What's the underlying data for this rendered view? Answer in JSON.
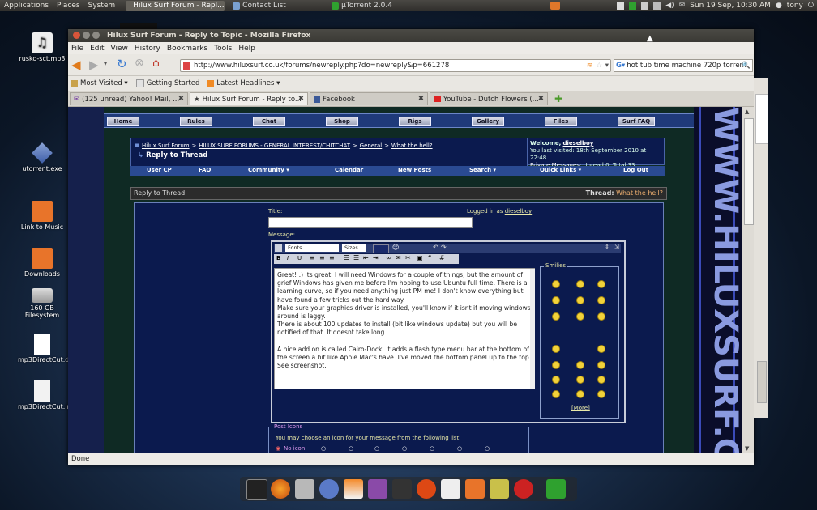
{
  "top_panel": {
    "menus": [
      "Applications",
      "Places",
      "System"
    ],
    "tasks": [
      {
        "label": "Hilux Surf Forum - Repl...",
        "active": true
      },
      {
        "label": "Contact List",
        "active": false
      },
      {
        "label": "µTorrent 2.0.4",
        "active": false
      }
    ],
    "clock": "Sun 19 Sep, 10:30 AM",
    "user": "tony"
  },
  "desktop_icons": [
    {
      "label": "rusko-sct.mp3",
      "icon": "music-file-icon"
    },
    {
      "label": "utorrent.exe",
      "icon": "executable-icon"
    },
    {
      "label": "Link to Music",
      "icon": "folder-icon"
    },
    {
      "label": "Downloads",
      "icon": "folder-icon"
    },
    {
      "label": "160 GB Filesystem",
      "icon": "drive-icon"
    },
    {
      "label": "mp3DirectCut.desktop",
      "icon": "text-file-icon"
    },
    {
      "label": "mp3DirectCut.lnk",
      "icon": "file-icon"
    }
  ],
  "firefox": {
    "window_title": "Hilux Surf Forum - Reply to Topic - Mozilla Firefox",
    "menus": [
      "File",
      "Edit",
      "View",
      "History",
      "Bookmarks",
      "Tools",
      "Help"
    ],
    "url": "http://www.hiluxsurf.co.uk/forums/newreply.php?do=newreply&p=661278",
    "search_text": "hot tub time machine 720p torrent",
    "bookmarks": [
      "Most Visited ▾",
      "Getting Started",
      "Latest Headlines ▾"
    ],
    "tabs": [
      {
        "label": "(125 unread) Yahoo! Mail, ...",
        "active": false
      },
      {
        "label": "Hilux Surf Forum - Reply to...",
        "active": true
      },
      {
        "label": "Facebook",
        "active": false
      },
      {
        "label": "YouTube - Dutch Flowers (...",
        "active": false
      }
    ],
    "status": "Done"
  },
  "forum": {
    "nav_buttons": [
      "Home",
      "Rules",
      "Chat",
      "Shop",
      "Rigs",
      "Gallery",
      "Files",
      "Surf FAQ"
    ],
    "breadcrumb": [
      "Hilux Surf Forum",
      "HILUX SURF FORUMS - GENERAL INTEREST/CHITCHAT",
      "General",
      "What the hell?"
    ],
    "page_heading": "Reply to Thread",
    "welcome_label": "Welcome,",
    "username": "dieselboy",
    "last_visited": "You last visited: 18th September 2010 at 22:48",
    "private_messages_label": "Private Messages",
    "private_messages_status": ": Unread 0, Total 33.",
    "subnav": [
      "User CP",
      "FAQ",
      "Community ▾",
      "Calendar",
      "New Posts",
      "Search ▾",
      "Quick Links ▾",
      "Log Out"
    ],
    "reply_header": "Reply to Thread",
    "thread_label": "Thread:",
    "thread_name": "What the hell?",
    "title_label": "Title:",
    "logged_in_label": "Logged in as",
    "logged_in_user": "dieselboy",
    "message_label": "Message:",
    "font_select": "Fonts",
    "size_select": "Sizes",
    "message_paragraphs": [
      "Great! :) Its great. I will need Windows for a couple of things, but the amount of grief Windows has given me before I'm hoping to use Ubuntu full time. There is a learning curve, so if you need anything just PM me! I don't know everything but have found a few tricks out the hard way.",
      "Make sure your graphics driver is installed, you'll know if it isnt if moving windows around is laggy.",
      "There is about 100 updates  to install (bit like windows update) but you will be notified of that. It doesnt take long.",
      "",
      "A nice add on is called Cairo-Dock. It adds a flash type menu bar at the bottom of the screen a bit like Apple Mac's have. I've moved the bottom panel up to the top. See screenshot."
    ],
    "smilies_label": "Smilies",
    "smilies_more": "[More]",
    "post_icons_label": "Post Icons",
    "post_icons_hint": "You may choose an icon for your message from the following list:",
    "no_icon_label": "No icon"
  },
  "colors": {
    "forum_bg": "#15204c",
    "forum_link": "#8fb3ff",
    "thread_name": "#f0b070"
  }
}
